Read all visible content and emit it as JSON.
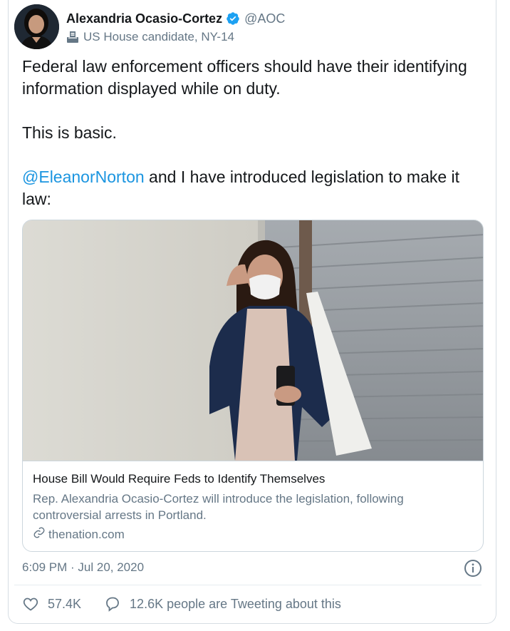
{
  "author": {
    "display_name": "Alexandria Ocasio-Cortez",
    "handle": "@AOC",
    "label": "US House candidate, NY-14",
    "verified": true
  },
  "tweet": {
    "line1": "Federal law enforcement officers should have their identifying information displayed while on duty.",
    "line2": "This is basic.",
    "mention": "@EleanorNorton",
    "line3_rest": " and I have introduced legislation to make it law:"
  },
  "card": {
    "title": "House Bill Would Require Feds to Identify Themselves",
    "description": "Rep. Alexandria Ocasio-Cortez will introduce the legislation, following controversial arrests in Portland.",
    "domain": "thenation.com"
  },
  "meta": {
    "timestamp": "6:09 PM · Jul 20, 2020"
  },
  "actions": {
    "likes": "57.4K",
    "tweeting_about": "12.6K people are Tweeting about this"
  },
  "icons": {
    "verified": "verified-badge-icon",
    "label": "ballot-box-icon",
    "link": "link-icon",
    "info": "info-icon",
    "like": "heart-icon",
    "reply": "speech-bubble-icon"
  },
  "colors": {
    "link": "#1b95e0",
    "secondary_text": "#657786",
    "primary_text": "#14171a",
    "verified": "#1da1f2"
  }
}
